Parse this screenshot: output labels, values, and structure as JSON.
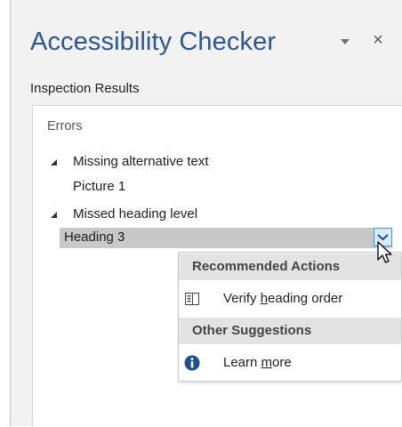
{
  "pane": {
    "title": "Accessibility Checker",
    "close_glyph": "×",
    "section_label": "Inspection Results"
  },
  "results": {
    "group_label": "Errors",
    "categories": [
      {
        "label": "Missing alternative text",
        "items": [
          "Picture 1"
        ]
      },
      {
        "label": "Missed heading level",
        "items": [
          "Heading 3"
        ]
      }
    ],
    "selected_item": "Heading 3"
  },
  "context_menu": {
    "recommended_header": "Recommended Actions",
    "verify_action": {
      "before": "Verify ",
      "accel": "h",
      "after": "eading order",
      "icon": "heading-order-icon"
    },
    "other_header": "Other Suggestions",
    "learn_action": {
      "before": "Learn ",
      "accel": "m",
      "after": "ore",
      "icon": "info-icon"
    }
  },
  "colors": {
    "title": "#2b579a",
    "pane_background": "#f2f2f2",
    "selection": "#c8c8c8",
    "menu_header": "#e3e3e3",
    "info_icon": "#1e4e8c"
  }
}
